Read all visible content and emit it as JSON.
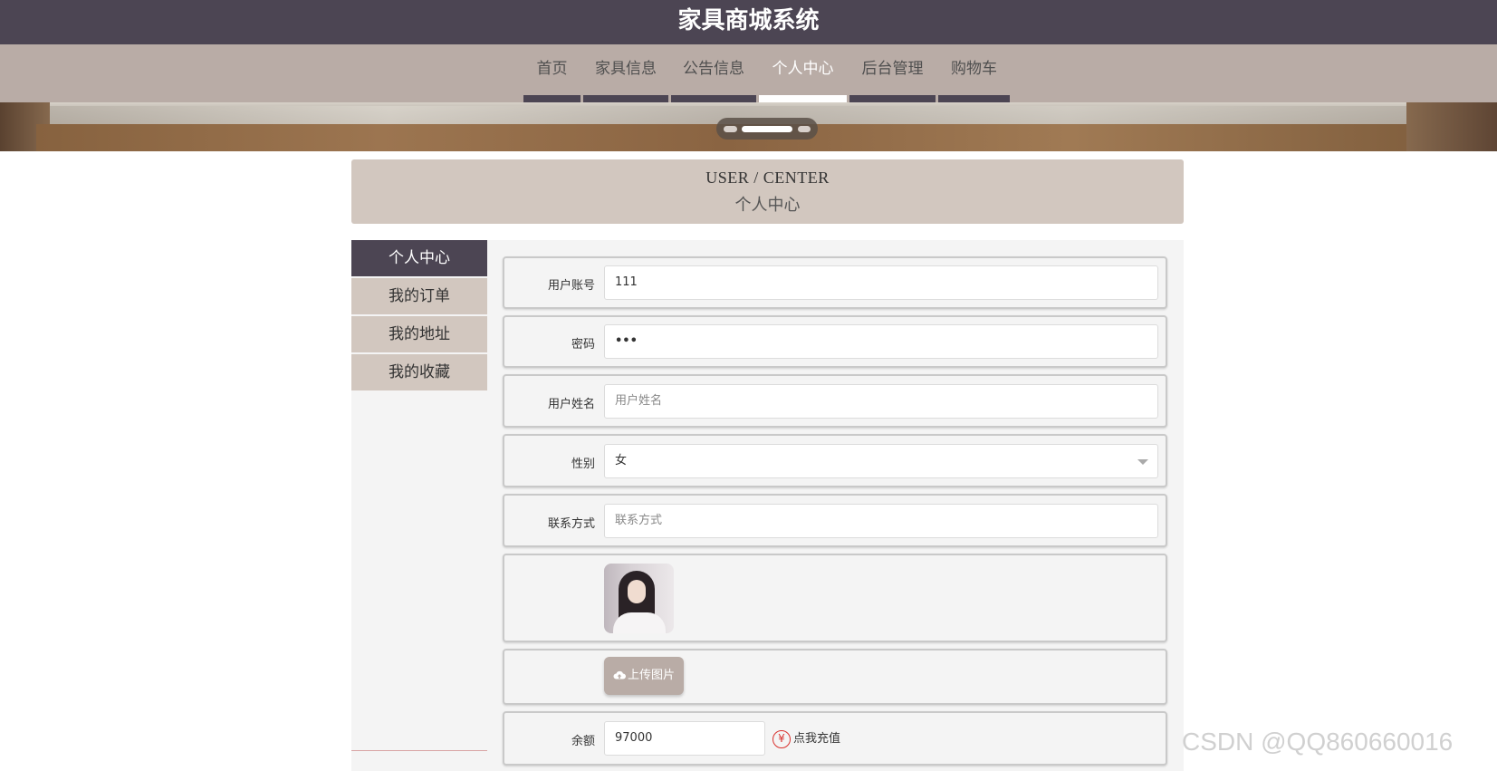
{
  "header": {
    "title": "家具商城系统",
    "bg_color": "#4c4553"
  },
  "nav": {
    "items": [
      {
        "label": "首页"
      },
      {
        "label": "家具信息"
      },
      {
        "label": "公告信息"
      },
      {
        "label": "个人中心"
      },
      {
        "label": "后台管理"
      },
      {
        "label": "购物车"
      }
    ],
    "active": "个人中心",
    "bg_color": "#b9aca6"
  },
  "banner": {
    "slide_count": 3,
    "active_slide": 2
  },
  "page_header": {
    "title_en": "USER / CENTER",
    "title_cn": "个人中心"
  },
  "sidebar": {
    "items": [
      {
        "label": "个人中心"
      },
      {
        "label": "我的订单"
      },
      {
        "label": "我的地址"
      },
      {
        "label": "我的收藏"
      }
    ],
    "active": "个人中心"
  },
  "form": {
    "account": {
      "label": "用户账号",
      "value": "111"
    },
    "password": {
      "label": "密码",
      "value": "•••"
    },
    "name": {
      "label": "用户姓名",
      "placeholder": "用户姓名"
    },
    "gender": {
      "label": "性别",
      "value": "女"
    },
    "contact": {
      "label": "联系方式",
      "placeholder": "联系方式"
    },
    "avatar": {
      "icon": "user-avatar-photo"
    },
    "upload": {
      "label": "上传图片",
      "icon": "cloud-upload-icon"
    },
    "balance": {
      "label": "余额",
      "value": "97000",
      "recharge_label": "点我充值",
      "recharge_icon": "yen-icon"
    }
  },
  "watermark": "CSDN @QQ860660016"
}
